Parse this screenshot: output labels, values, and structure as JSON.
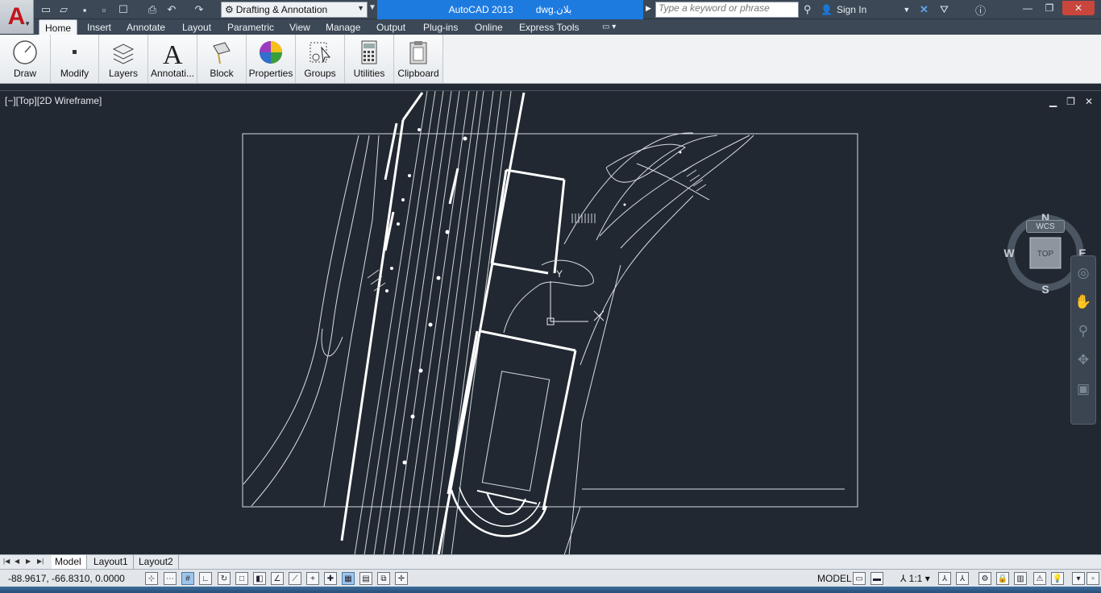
{
  "title_bar": {
    "app_name": "AutoCAD 2013",
    "file_name": "بلان.dwg",
    "workspace": "Drafting & Annotation",
    "search_placeholder": "Type a keyword or phrase",
    "sign_in": "Sign In"
  },
  "menu_tabs": [
    "Home",
    "Insert",
    "Annotate",
    "Layout",
    "Parametric",
    "View",
    "Manage",
    "Output",
    "Plug-ins",
    "Online",
    "Express Tools"
  ],
  "ribbon_panels": [
    "Draw",
    "Modify",
    "Layers",
    "Annotati...",
    "Block",
    "Properties",
    "Groups",
    "Utilities",
    "Clipboard"
  ],
  "viewport": {
    "label": "[−][Top][2D Wireframe]",
    "ucs_y_label": "Y",
    "viewcube": {
      "top": "TOP",
      "north": "N",
      "south": "S",
      "east": "E",
      "west": "W",
      "wcs": "WCS"
    }
  },
  "layout_tabs": [
    "Model",
    "Layout1",
    "Layout2"
  ],
  "status": {
    "coordinates": "-88.9617, -66.8310, 0.0000",
    "model_label": "MODEL",
    "annotation_scale": "1:1"
  },
  "colors": {
    "titlebar": "#3c4856",
    "title_highlight": "#1d7be0",
    "drawing_background": "#212831",
    "linework": "#ffffff"
  },
  "icons": [
    "application-menu-icon",
    "new-icon",
    "open-icon",
    "save-icon",
    "save-as-icon",
    "plot-icon",
    "undo-icon",
    "redo-icon",
    "gear-icon",
    "binoculars-icon",
    "user-icon",
    "exchange-icon",
    "autodesk360-icon",
    "help-icon",
    "minimize-icon",
    "restore-icon",
    "close-icon",
    "pan-icon",
    "orbit-icon",
    "zoom-icon",
    "steering-wheel-icon"
  ]
}
